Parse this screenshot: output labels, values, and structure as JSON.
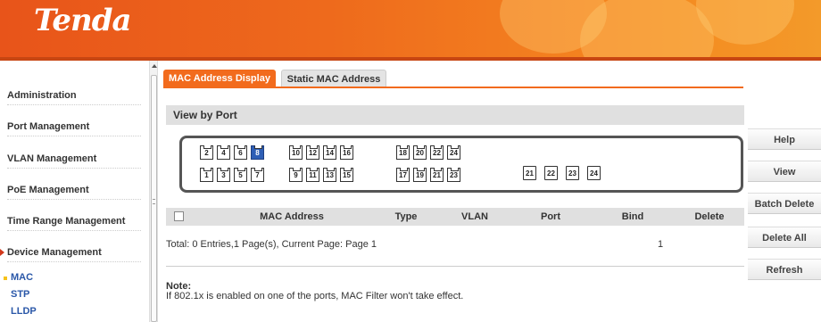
{
  "header": {
    "logo": "Tenda"
  },
  "sidebar": {
    "items": [
      {
        "label": "Administration"
      },
      {
        "label": "Port Management"
      },
      {
        "label": "VLAN Management"
      },
      {
        "label": "PoE Management"
      },
      {
        "label": "Time Range Management"
      },
      {
        "label": "Device Management"
      }
    ],
    "sub_items": [
      {
        "label": "MAC"
      },
      {
        "label": "STP"
      },
      {
        "label": "LLDP"
      }
    ]
  },
  "tabs": [
    {
      "label": "MAC Address Display",
      "active": true
    },
    {
      "label": "Static MAC Address",
      "active": false
    }
  ],
  "section": {
    "title": "View by Port"
  },
  "ports": {
    "top_row": [
      "2",
      "4",
      "6",
      "8",
      "10",
      "12",
      "14",
      "16",
      "18",
      "20",
      "22",
      "24"
    ],
    "bottom_row": [
      "1",
      "3",
      "5",
      "7",
      "9",
      "11",
      "13",
      "15",
      "17",
      "19",
      "21",
      "23"
    ],
    "sfp": [
      "21",
      "22",
      "23",
      "24"
    ],
    "selected": "8"
  },
  "table": {
    "headers": [
      "MAC Address",
      "Type",
      "VLAN",
      "Port",
      "Bind",
      "Delete"
    ],
    "total": "Total: 0 Entries,1 Page(s), Current Page: Page 1",
    "page_number": "1"
  },
  "note": {
    "label": "Note:",
    "text": "If 802.1x is enabled on one of the ports, MAC Filter won't take effect."
  },
  "buttons": {
    "help": "Help",
    "view": "View",
    "batch_delete": "Batch Delete",
    "delete_all": "Delete All",
    "refresh": "Refresh"
  },
  "colors": {
    "brand": "#f26b1d",
    "selected_port": "#2f5fb6",
    "active_marker": "#d2391c",
    "sub_item_text": "#2a57a8"
  }
}
